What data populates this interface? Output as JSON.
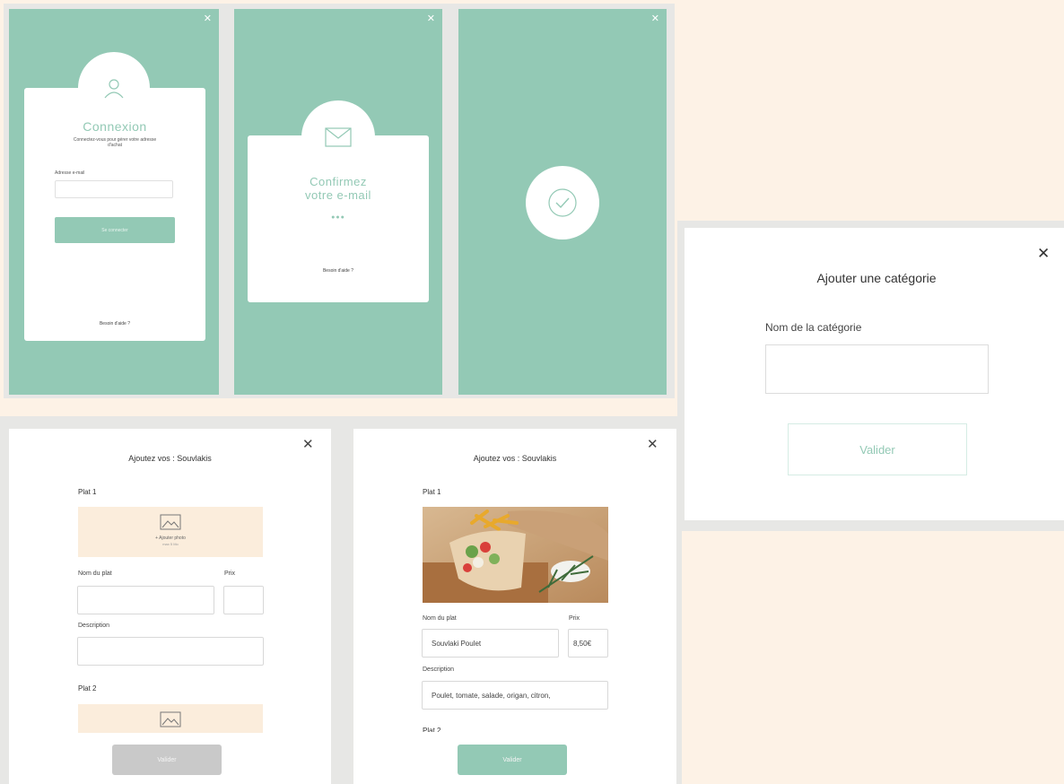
{
  "login": {
    "title": "Connexion",
    "subtitle": "Connectez-vous pour gérer votre adresse d'achat",
    "email_label": "Adresse e-mail",
    "submit_label": "Se connecter",
    "help_link": "Besoin d'aide ?"
  },
  "confirm": {
    "title_line1": "Confirmez",
    "title_line2": "votre e-mail",
    "dots": "●●●",
    "help_link": "Besoin d'aide ?"
  },
  "success": {},
  "category_modal": {
    "title": "Ajouter une catégorie",
    "name_label": "Nom de la catégorie",
    "name_value": "",
    "submit_label": "Valider",
    "close": "✕"
  },
  "add_dish_empty": {
    "title": "Ajoutez vos : Souvlakis",
    "close": "✕",
    "plat1": "Plat 1",
    "photo_label": "+ Ajouter photo",
    "photo_hint": "max 5 Mo",
    "dish_name_label": "Nom du plat",
    "price_label": "Prix",
    "description_label": "Description",
    "plat2": "Plat 2",
    "submit_label": "Valider"
  },
  "add_dish_filled": {
    "title": "Ajoutez vos : Souvlakis",
    "close": "✕",
    "plat1": "Plat 1",
    "dish_name_label": "Nom du plat",
    "dish_name_value": "Souvlaki Poulet",
    "price_label": "Prix",
    "price_value": "8,50€",
    "description_label": "Description",
    "description_value": "Poulet, tomate, salade, origan, citron,",
    "plat2": "Plat 2",
    "submit_label": "Valider"
  },
  "colors": {
    "mint": "#93c9b5",
    "cream": "#fdf2e6",
    "photo_bg": "#fbeddc",
    "disabled": "#c9c9c9"
  }
}
